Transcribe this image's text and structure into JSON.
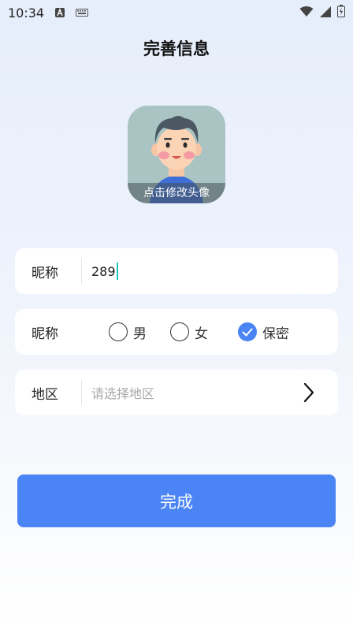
{
  "status_bar": {
    "time": "10:34"
  },
  "header": {
    "title": "完善信息"
  },
  "avatar": {
    "label": "点击修改头像"
  },
  "nickname": {
    "label": "昵称",
    "value": "289"
  },
  "gender": {
    "label": "昵称",
    "options": [
      {
        "label": "男",
        "checked": false
      },
      {
        "label": "女",
        "checked": false
      },
      {
        "label": "保密",
        "checked": true
      }
    ]
  },
  "region": {
    "label": "地区",
    "placeholder": "请选择地区"
  },
  "actions": {
    "submit_label": "完成"
  },
  "colors": {
    "primary": "#4a84f5",
    "caret": "#23c4c4"
  }
}
